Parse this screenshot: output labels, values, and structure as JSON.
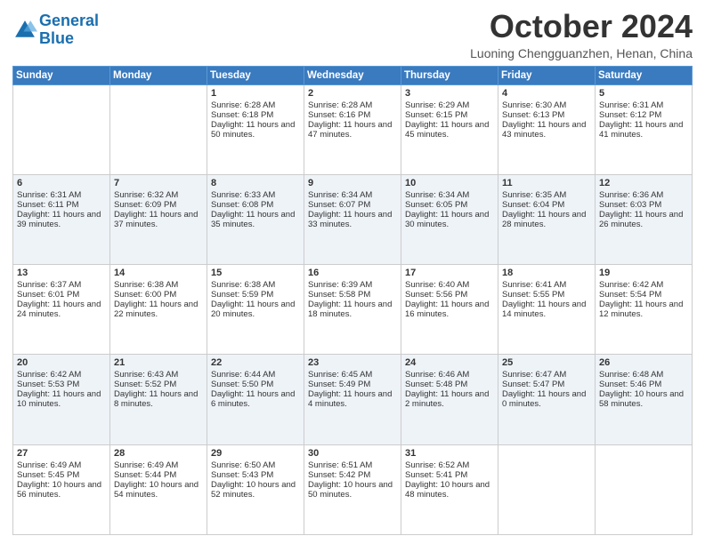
{
  "header": {
    "logo_line1": "General",
    "logo_line2": "Blue",
    "month": "October 2024",
    "location": "Luoning Chengguanzhen, Henan, China"
  },
  "days_of_week": [
    "Sunday",
    "Monday",
    "Tuesday",
    "Wednesday",
    "Thursday",
    "Friday",
    "Saturday"
  ],
  "weeks": [
    [
      {
        "day": "",
        "text": ""
      },
      {
        "day": "",
        "text": ""
      },
      {
        "day": "1",
        "text": "Sunrise: 6:28 AM\nSunset: 6:18 PM\nDaylight: 11 hours and 50 minutes."
      },
      {
        "day": "2",
        "text": "Sunrise: 6:28 AM\nSunset: 6:16 PM\nDaylight: 11 hours and 47 minutes."
      },
      {
        "day": "3",
        "text": "Sunrise: 6:29 AM\nSunset: 6:15 PM\nDaylight: 11 hours and 45 minutes."
      },
      {
        "day": "4",
        "text": "Sunrise: 6:30 AM\nSunset: 6:13 PM\nDaylight: 11 hours and 43 minutes."
      },
      {
        "day": "5",
        "text": "Sunrise: 6:31 AM\nSunset: 6:12 PM\nDaylight: 11 hours and 41 minutes."
      }
    ],
    [
      {
        "day": "6",
        "text": "Sunrise: 6:31 AM\nSunset: 6:11 PM\nDaylight: 11 hours and 39 minutes."
      },
      {
        "day": "7",
        "text": "Sunrise: 6:32 AM\nSunset: 6:09 PM\nDaylight: 11 hours and 37 minutes."
      },
      {
        "day": "8",
        "text": "Sunrise: 6:33 AM\nSunset: 6:08 PM\nDaylight: 11 hours and 35 minutes."
      },
      {
        "day": "9",
        "text": "Sunrise: 6:34 AM\nSunset: 6:07 PM\nDaylight: 11 hours and 33 minutes."
      },
      {
        "day": "10",
        "text": "Sunrise: 6:34 AM\nSunset: 6:05 PM\nDaylight: 11 hours and 30 minutes."
      },
      {
        "day": "11",
        "text": "Sunrise: 6:35 AM\nSunset: 6:04 PM\nDaylight: 11 hours and 28 minutes."
      },
      {
        "day": "12",
        "text": "Sunrise: 6:36 AM\nSunset: 6:03 PM\nDaylight: 11 hours and 26 minutes."
      }
    ],
    [
      {
        "day": "13",
        "text": "Sunrise: 6:37 AM\nSunset: 6:01 PM\nDaylight: 11 hours and 24 minutes."
      },
      {
        "day": "14",
        "text": "Sunrise: 6:38 AM\nSunset: 6:00 PM\nDaylight: 11 hours and 22 minutes."
      },
      {
        "day": "15",
        "text": "Sunrise: 6:38 AM\nSunset: 5:59 PM\nDaylight: 11 hours and 20 minutes."
      },
      {
        "day": "16",
        "text": "Sunrise: 6:39 AM\nSunset: 5:58 PM\nDaylight: 11 hours and 18 minutes."
      },
      {
        "day": "17",
        "text": "Sunrise: 6:40 AM\nSunset: 5:56 PM\nDaylight: 11 hours and 16 minutes."
      },
      {
        "day": "18",
        "text": "Sunrise: 6:41 AM\nSunset: 5:55 PM\nDaylight: 11 hours and 14 minutes."
      },
      {
        "day": "19",
        "text": "Sunrise: 6:42 AM\nSunset: 5:54 PM\nDaylight: 11 hours and 12 minutes."
      }
    ],
    [
      {
        "day": "20",
        "text": "Sunrise: 6:42 AM\nSunset: 5:53 PM\nDaylight: 11 hours and 10 minutes."
      },
      {
        "day": "21",
        "text": "Sunrise: 6:43 AM\nSunset: 5:52 PM\nDaylight: 11 hours and 8 minutes."
      },
      {
        "day": "22",
        "text": "Sunrise: 6:44 AM\nSunset: 5:50 PM\nDaylight: 11 hours and 6 minutes."
      },
      {
        "day": "23",
        "text": "Sunrise: 6:45 AM\nSunset: 5:49 PM\nDaylight: 11 hours and 4 minutes."
      },
      {
        "day": "24",
        "text": "Sunrise: 6:46 AM\nSunset: 5:48 PM\nDaylight: 11 hours and 2 minutes."
      },
      {
        "day": "25",
        "text": "Sunrise: 6:47 AM\nSunset: 5:47 PM\nDaylight: 11 hours and 0 minutes."
      },
      {
        "day": "26",
        "text": "Sunrise: 6:48 AM\nSunset: 5:46 PM\nDaylight: 10 hours and 58 minutes."
      }
    ],
    [
      {
        "day": "27",
        "text": "Sunrise: 6:49 AM\nSunset: 5:45 PM\nDaylight: 10 hours and 56 minutes."
      },
      {
        "day": "28",
        "text": "Sunrise: 6:49 AM\nSunset: 5:44 PM\nDaylight: 10 hours and 54 minutes."
      },
      {
        "day": "29",
        "text": "Sunrise: 6:50 AM\nSunset: 5:43 PM\nDaylight: 10 hours and 52 minutes."
      },
      {
        "day": "30",
        "text": "Sunrise: 6:51 AM\nSunset: 5:42 PM\nDaylight: 10 hours and 50 minutes."
      },
      {
        "day": "31",
        "text": "Sunrise: 6:52 AM\nSunset: 5:41 PM\nDaylight: 10 hours and 48 minutes."
      },
      {
        "day": "",
        "text": ""
      },
      {
        "day": "",
        "text": ""
      }
    ]
  ]
}
